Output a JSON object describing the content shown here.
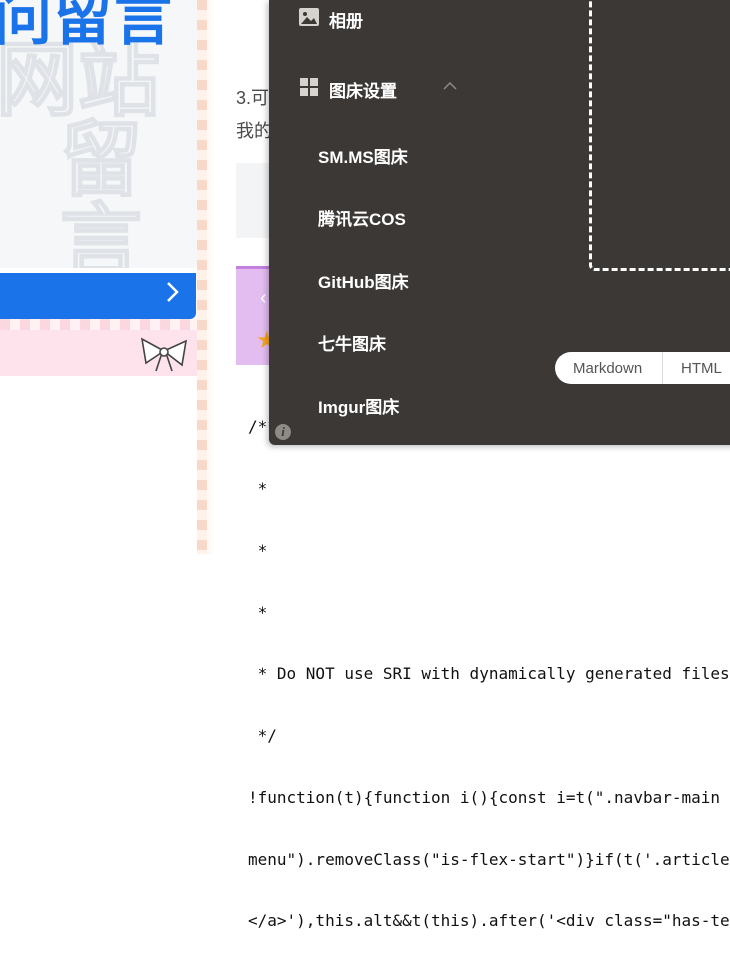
{
  "banner": {
    "title_fragment": "问留言"
  },
  "article": {
    "line1": "3.可",
    "line2": "我的"
  },
  "code_lines": [
    "/**",
    " *",
    " *",
    " *",
    " * Do NOT use SRI with dynamically generated files!",
    " */",
    "!function(t){function i(){const i=t(\".navbar-main .",
    "menu\").removeClass(\"is-flex-start\")}if(t('.article",
    "</a>'),this.alt&&t(this).after('<div class=\"has-tex"
  ],
  "menu": {
    "album": "相册",
    "settings": "图床设置",
    "items": [
      "SM.MS图床",
      "腾讯云COS",
      "GitHub图床",
      "七牛图床",
      "Imgur图床"
    ]
  },
  "format": {
    "markdown": "Markdown",
    "html": "HTML"
  },
  "icons": [
    "image-icon",
    "grid-icon",
    "chevron-up-icon",
    "chevron-right-icon",
    "info-icon",
    "bow-icon",
    "star-icon",
    "chevron-left-icon"
  ]
}
